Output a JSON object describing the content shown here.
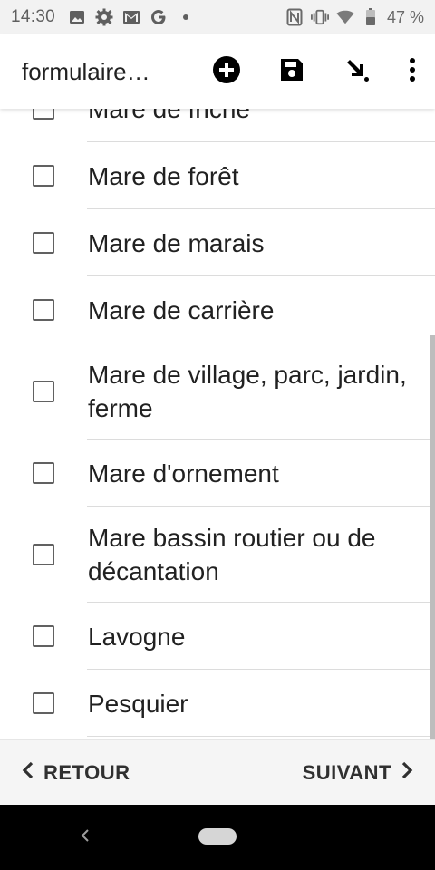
{
  "status_bar": {
    "time": "14:30",
    "left_icons": [
      "image-icon",
      "gear-icon",
      "mail-icon",
      "google-icon",
      "dot-icon"
    ],
    "right_icons": [
      "nfc-icon",
      "vibrate-icon",
      "wifi-icon",
      "battery-icon"
    ],
    "battery": "47 %"
  },
  "app_bar": {
    "title": "formulaire…",
    "actions": [
      "add-circle-icon",
      "save-icon",
      "arrow-down-right-icon",
      "more-vert-icon"
    ]
  },
  "list": {
    "items": [
      {
        "label": "Mare de friche",
        "checked": false
      },
      {
        "label": "Mare de forêt",
        "checked": false
      },
      {
        "label": "Mare de marais",
        "checked": false
      },
      {
        "label": "Mare de carrière",
        "checked": false
      },
      {
        "label": "Mare de village, parc, jardin, ferme",
        "checked": false
      },
      {
        "label": "Mare d'ornement",
        "checked": false
      },
      {
        "label": "Mare bassin routier ou de décantation",
        "checked": false
      },
      {
        "label": "Lavogne",
        "checked": false
      },
      {
        "label": "Pesquier",
        "checked": false
      }
    ]
  },
  "bottom_nav": {
    "back_label": "RETOUR",
    "next_label": "SUIVANT"
  },
  "colors": {
    "status_bg": "#f2f2f2",
    "checkbox_border": "#616161",
    "divider": "#dcdcdc",
    "nav_bg": "#f5f5f5",
    "system_nav_bg": "#000000"
  }
}
